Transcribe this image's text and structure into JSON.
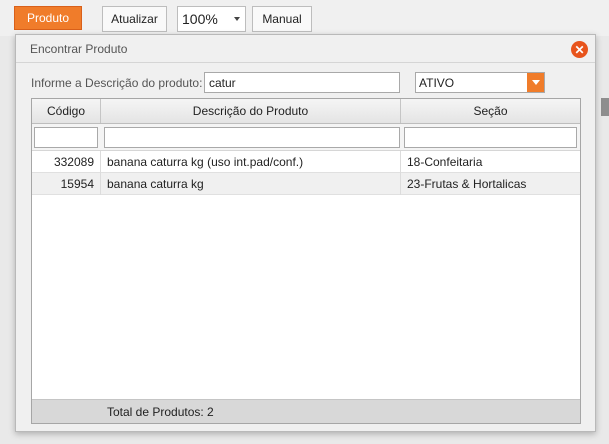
{
  "toolbar": {
    "produto_label": "Produto",
    "atualizar_label": "Atualizar",
    "zoom_value": "100%",
    "manual_label": "Manual"
  },
  "modal": {
    "title": "Encontrar Produto",
    "close_glyph": "✕",
    "search_label": "Informe a Descrição do produto:",
    "search_value": "catur",
    "status_value": "ATIVO",
    "columns": [
      "Código",
      "Descrição do Produto",
      "Seção"
    ],
    "rows": [
      {
        "codigo": "332089",
        "descricao": "banana caturra kg (uso int.pad/conf.)",
        "secao": "18-Confeitaria"
      },
      {
        "codigo": "15954",
        "descricao": "banana caturra kg",
        "secao": "23-Frutas & Hortalicas"
      }
    ],
    "footer": "Total de Produtos: 2"
  },
  "colors": {
    "accent": "#f07c2a",
    "close": "#e8541c"
  }
}
